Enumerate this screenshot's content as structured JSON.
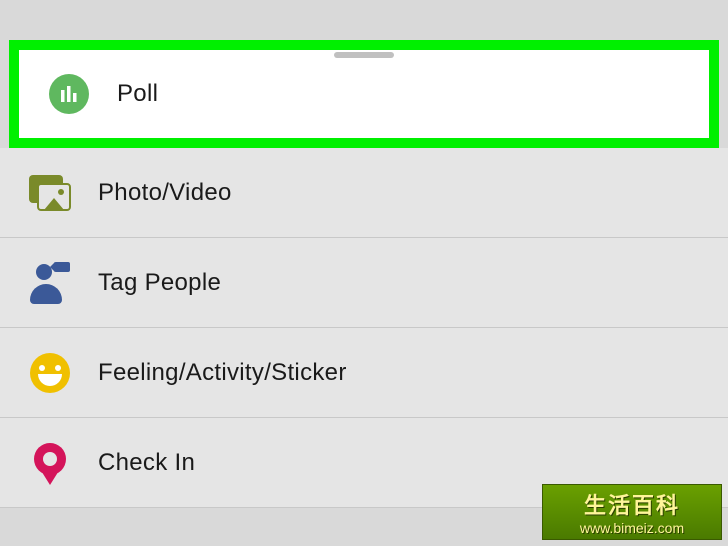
{
  "menu": {
    "poll": {
      "label": "Poll"
    },
    "photo_video": {
      "label": "Photo/Video"
    },
    "tag_people": {
      "label": "Tag People"
    },
    "feeling": {
      "label": "Feeling/Activity/Sticker"
    },
    "check_in": {
      "label": "Check In"
    }
  },
  "watermark": {
    "title_cn": "生活百科",
    "url": "www.bimeiz.com"
  },
  "colors": {
    "highlight": "#00f000",
    "poll_icon": "#5fb85f",
    "photo_icon": "#7a8a2a",
    "tag_icon": "#3b5998",
    "feeling_icon": "#f0c000",
    "checkin_icon": "#d4145a"
  }
}
